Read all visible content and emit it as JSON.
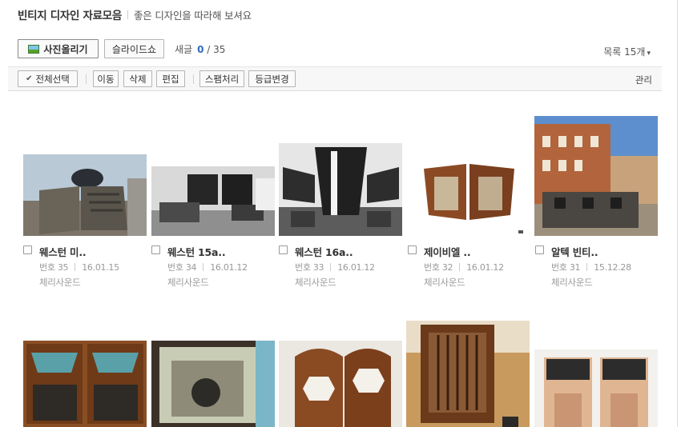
{
  "header": {
    "title": "빈티지 디자인 자료모음",
    "description": "좋은 디자인을 따라해 보셔요"
  },
  "toolbar": {
    "photo_upload": "사진올리기",
    "slideshow": "슬라이드쇼",
    "new_label": "새글",
    "new_count": "0",
    "total_count": "/ 35",
    "list_label": "목록 15개",
    "list_caret": "▾"
  },
  "actions": {
    "select_all": "전체선택",
    "move": "이동",
    "delete": "삭제",
    "edit": "편집",
    "spam": "스팸처리",
    "change_grade": "등급변경",
    "manage": "관리"
  },
  "posts": [
    {
      "title": "웨스턴 미..",
      "number_label": "번호 35",
      "date": "16.01.15",
      "author": "체리사운드"
    },
    {
      "title": "웨스턴 15a..",
      "number_label": "번호 34",
      "date": "16.01.12",
      "author": "체리사운드"
    },
    {
      "title": "웨스턴 16a..",
      "number_label": "번호 33",
      "date": "16.01.12",
      "author": "체리사운드"
    },
    {
      "title": "제이비엘 ..",
      "number_label": "번호 32",
      "date": "16.01.12",
      "author": "체리사운드"
    },
    {
      "title": "알텍 빈티..",
      "number_label": "번호 31",
      "date": "15.12.28",
      "author": "체리사운드"
    }
  ],
  "colors": {
    "accent_blue": "#2f6bc2",
    "text_gray": "#999999",
    "toolbar_bg": "#f7f7f7"
  }
}
